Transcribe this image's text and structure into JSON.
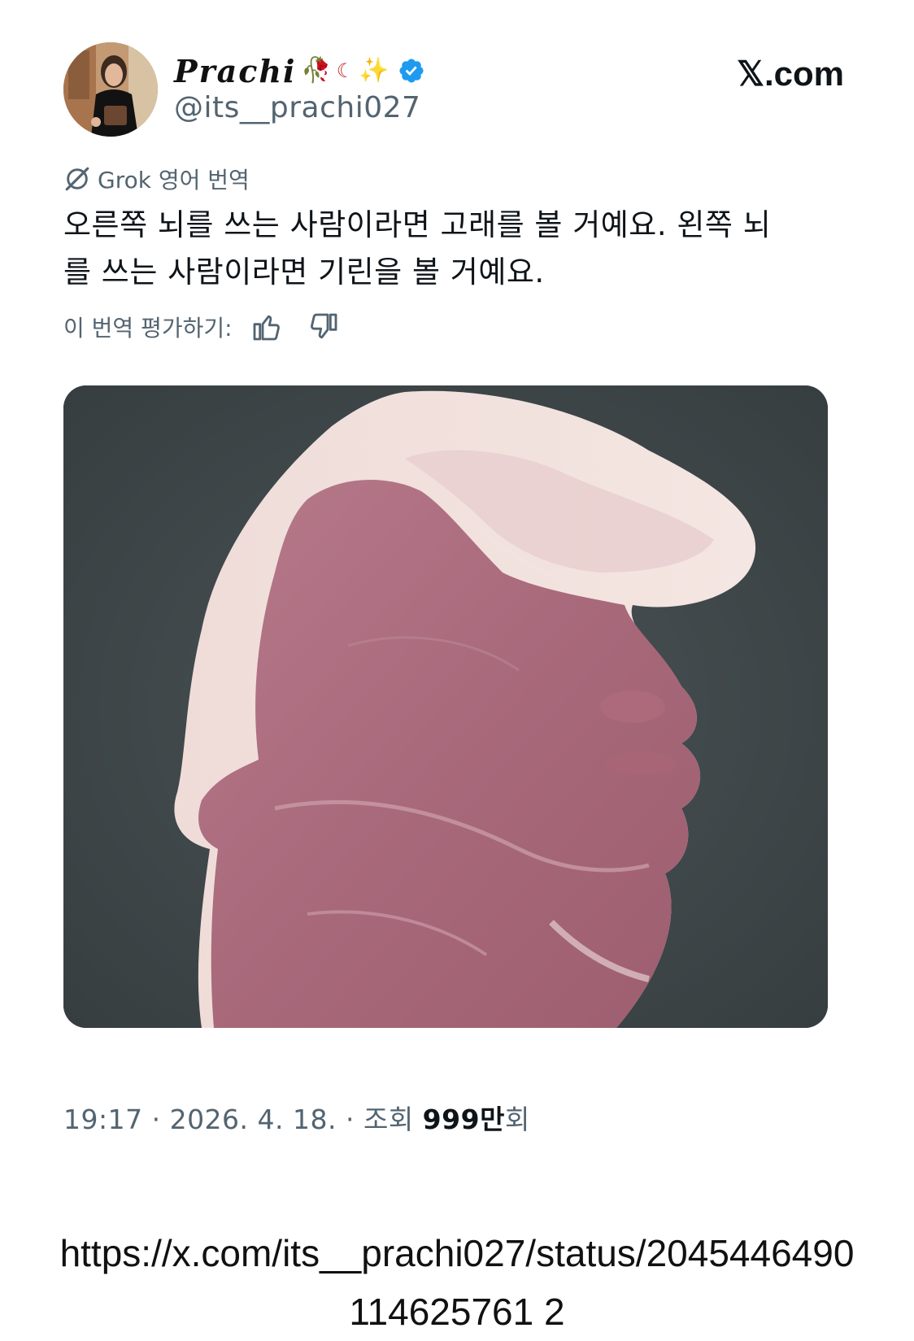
{
  "header": {
    "display_name": "Prachi",
    "name_emojis": {
      "rose": "🥀",
      "moon": "☾",
      "sparkles": "✨"
    },
    "handle": "@its__prachi027",
    "brand": "𝕏.com",
    "verified_color": "#1d9bf0"
  },
  "translation": {
    "tag_label": "Grok 영어 번역",
    "text_line1": "오른쪽 뇌를 쓰는 사람이라면 고래를 볼 거예요. 왼쪽 뇌",
    "text_line2": "를 쓰는 사람이라면 기린을 볼 거예요.",
    "rate_label": "이 번역 평가하기:",
    "icons": [
      "grok-icon",
      "thumbs-up-icon",
      "thumbs-down-icon"
    ]
  },
  "media": {
    "description_icon": "meat-image"
  },
  "meta": {
    "time": "19:17 · 2026. 4. 18. · 조회 ",
    "views_number": "999",
    "views_unit": "만",
    "views_suffix": "회"
  },
  "url": {
    "text": "https://x.com/its__prachi027/status/2045446490114625761 2"
  },
  "colors": {
    "text_primary": "#0f1419",
    "text_secondary": "#536471",
    "media_bg": "#3e4749"
  }
}
